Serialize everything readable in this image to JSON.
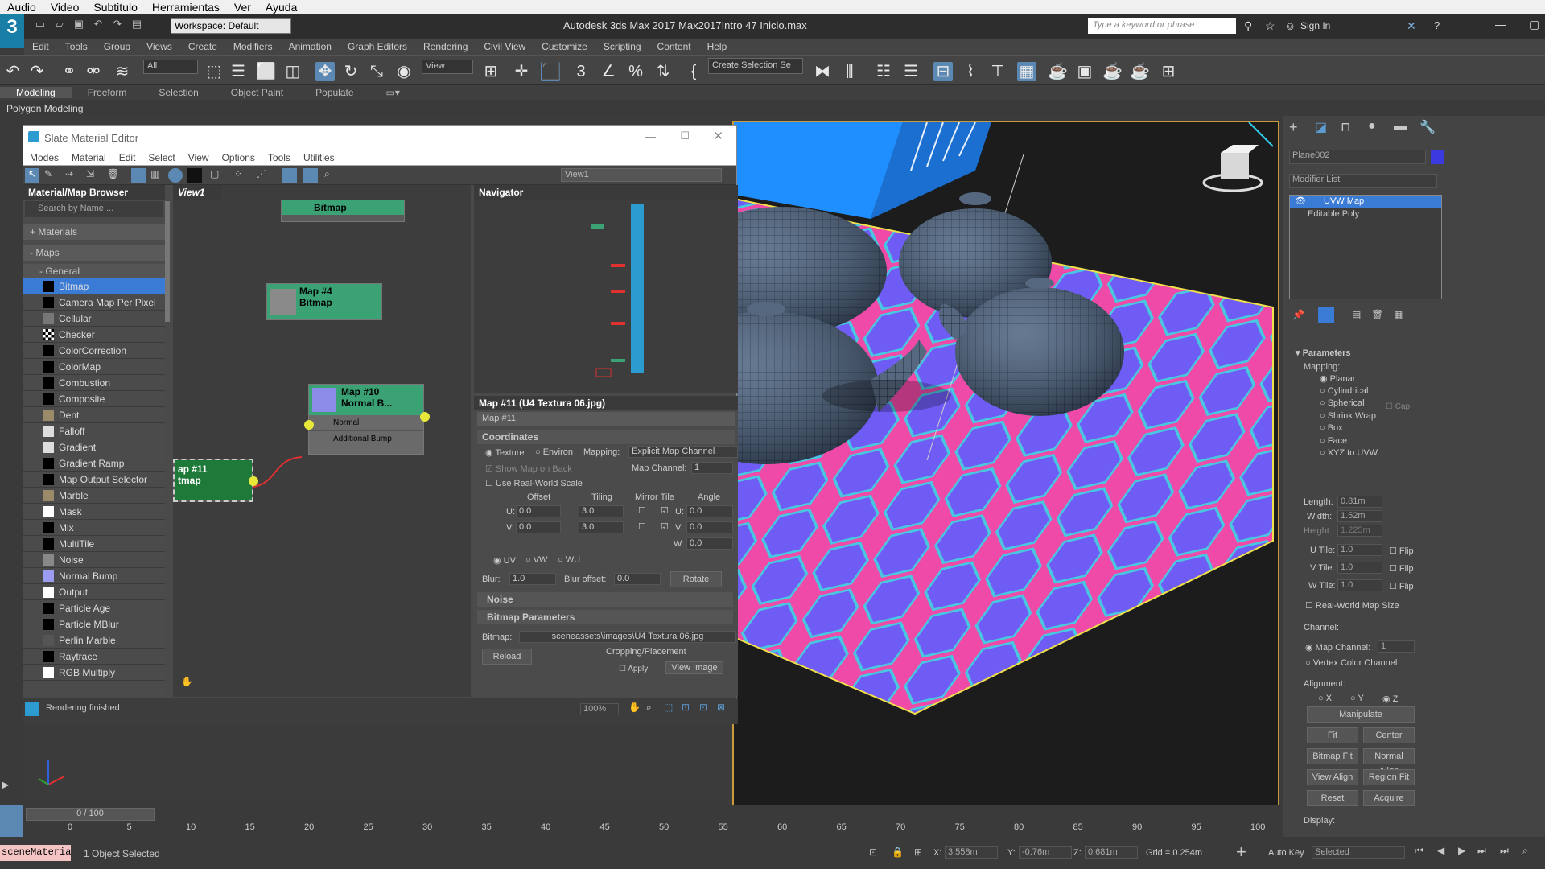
{
  "os_menu": [
    "Audio",
    "Video",
    "Subtitulo",
    "Herramientas",
    "Ver",
    "Ayuda"
  ],
  "titlebar": {
    "workspace": "Workspace: Default",
    "app_title": "Autodesk 3ds Max 2017      Max2017Intro 47 Inicio.max",
    "search_placeholder": "Type a keyword or phrase",
    "sign_in": "Sign In"
  },
  "menubar": [
    "Edit",
    "Tools",
    "Group",
    "Views",
    "Create",
    "Modifiers",
    "Animation",
    "Graph Editors",
    "Rendering",
    "Civil View",
    "Customize",
    "Scripting",
    "Content",
    "Help"
  ],
  "toolbar": {
    "filter": "All",
    "ref_coord": "View",
    "selection_set": "Create Selection Se"
  },
  "ribbon": {
    "tabs": [
      "Modeling",
      "Freeform",
      "Selection",
      "Object Paint",
      "Populate"
    ],
    "sub": "Polygon Modeling"
  },
  "slate": {
    "title": "Slate Material Editor",
    "menu": [
      "Modes",
      "Material",
      "Edit",
      "Select",
      "View",
      "Options",
      "Tools",
      "Utilities"
    ],
    "view_dropdown": "View1",
    "browser": {
      "title": "Material/Map Browser",
      "search": "Search by Name ...",
      "materials": "+ Materials",
      "maps": "- Maps",
      "general": "- General",
      "items": [
        "Bitmap",
        "Camera Map Per Pixel",
        "Cellular",
        "Checker",
        "ColorCorrection",
        "ColorMap",
        "Combustion",
        "Composite",
        "Dent",
        "Falloff",
        "Gradient",
        "Gradient Ramp",
        "Map Output Selector",
        "Marble",
        "Mask",
        "Mix",
        "MultiTile",
        "Noise",
        "Normal Bump",
        "Output",
        "Particle Age",
        "Particle MBlur",
        "Perlin Marble",
        "Raytrace",
        "RGB Multiply"
      ]
    },
    "view_tab": "View1",
    "nodes": {
      "top": "Bitmap",
      "map4": [
        "Map #4",
        "Bitmap"
      ],
      "map10": [
        "Map #10",
        "Normal B..."
      ],
      "map10_slots": [
        "Normal",
        "Additional Bump"
      ],
      "map11": [
        "ap #11",
        "tmap"
      ]
    },
    "navigator": "Navigator",
    "params": {
      "header": "Map #11  (U4 Textura 06.jpg)",
      "name": "Map #11",
      "coordinates": "Coordinates",
      "texture": "Texture",
      "environ": "Environ",
      "mapping_lbl": "Mapping:",
      "mapping_val": "Explicit Map Channel",
      "show_on_back": "Show Map on Back",
      "map_channel_lbl": "Map Channel:",
      "map_channel_val": "1",
      "real_world": "Use Real-World Scale",
      "cols": [
        "Offset",
        "Tiling",
        "Mirror Tile",
        "Angle"
      ],
      "u_lbl": "U:",
      "v_lbl": "V:",
      "w_lbl": "W:",
      "u_off": "0.0",
      "v_off": "0.0",
      "u_tile": "3.0",
      "v_tile": "3.0",
      "u_ang": "0.0",
      "v_ang": "0.0",
      "w_ang": "0.0",
      "uv": "UV",
      "vw": "VW",
      "wu": "WU",
      "blur_lbl": "Blur:",
      "blur_val": "1.0",
      "bluroff_lbl": "Blur offset:",
      "bluroff_val": "0.0",
      "rotate": "Rotate",
      "noise": "Noise",
      "bitmap_params": "Bitmap Parameters",
      "bitmap_lbl": "Bitmap:",
      "bitmap_val": "sceneassets\\images\\U4 Textura 06.jpg",
      "reload": "Reload",
      "cropping": "Cropping/Placement",
      "apply": "Apply",
      "view_image": "View Image"
    },
    "zoom": "100%",
    "status": "Rendering finished"
  },
  "cmd": {
    "object_name": "Plane002",
    "modifier_list": "Modifier List",
    "stack": [
      "UVW Map",
      "Editable Poly"
    ],
    "parameters": "Parameters",
    "mapping": "Mapping:",
    "mapping_types": [
      "Planar",
      "Cylindrical",
      "Spherical",
      "Shrink Wrap",
      "Box",
      "Face",
      "XYZ to UVW"
    ],
    "cap": "Cap",
    "length_lbl": "Length:",
    "length": "0.81m",
    "width_lbl": "Width:",
    "width": "1.52m",
    "height_lbl": "Height:",
    "height": "1.225m",
    "utile_lbl": "U Tile:",
    "vtile_lbl": "V Tile:",
    "wtile_lbl": "W Tile:",
    "utile": "1.0",
    "vtile": "1.0",
    "wtile": "1.0",
    "flip": "Flip",
    "real_world": "Real-World Map Size",
    "channel": "Channel:",
    "map_channel": "Map Channel:",
    "map_channel_val": "1",
    "vertex_color": "Vertex Color Channel",
    "alignment": "Alignment:",
    "axes": [
      "X",
      "Y",
      "Z"
    ],
    "buttons": [
      "Manipulate",
      "Fit",
      "Center",
      "Bitmap Fit",
      "Normal Align",
      "View Align",
      "Region Fit",
      "Reset",
      "Acquire"
    ],
    "display": "Display:"
  },
  "timeline": {
    "frame": "0 / 100",
    "ticks": [
      "0",
      "5",
      "10",
      "15",
      "20",
      "25",
      "30",
      "35",
      "40",
      "45",
      "50",
      "55",
      "60",
      "65",
      "70",
      "75",
      "80",
      "85",
      "90",
      "95",
      "100"
    ]
  },
  "statusbar": {
    "script": "sceneMateria",
    "selected": "1 Object Selected",
    "x_lbl": "X:",
    "x": "3.558m",
    "y_lbl": "Y:",
    "y": "-0.76m",
    "z_lbl": "Z:",
    "z": "0.681m",
    "grid": "Grid = 0.254m",
    "autokey": "Auto Key",
    "key_mode": "Selected"
  },
  "colors": {
    "accent": "#5b89b3",
    "node_green": "#3aa275",
    "selection_blue": "#3a7bd5",
    "viewport_border": "#c99a3b"
  }
}
